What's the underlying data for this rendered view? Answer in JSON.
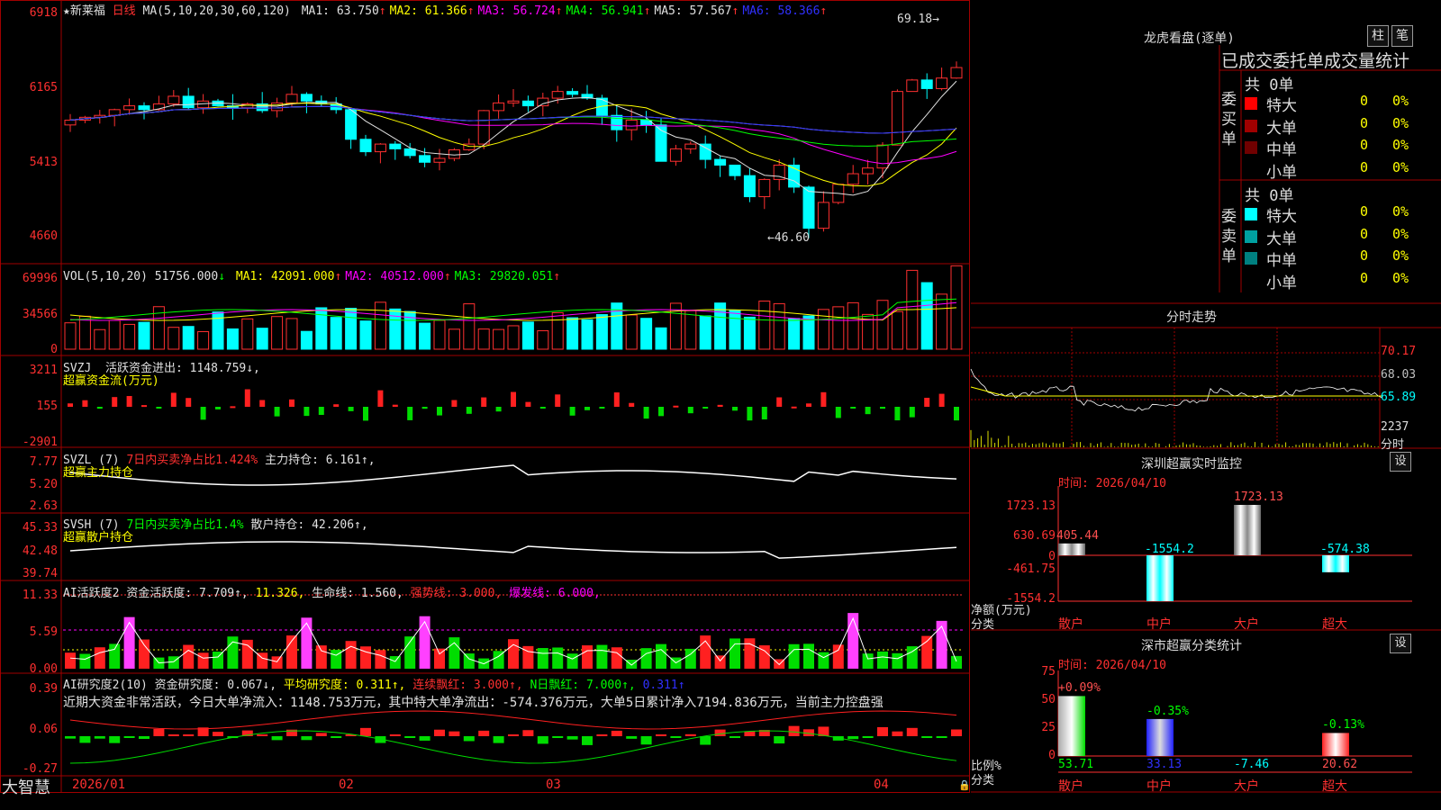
{
  "stock": {
    "name": "★新莱福",
    "period": "日线"
  },
  "main": {
    "ma_label": "MA(5,10,20,30,60,120)",
    "ma": [
      {
        "label": "MA1:",
        "value": "63.750",
        "arrow": "↑",
        "color": "#e0e0e0"
      },
      {
        "label": "MA2:",
        "value": "61.366",
        "arrow": "↑",
        "color": "#ffff00"
      },
      {
        "label": "MA3:",
        "value": "56.724",
        "arrow": "↑",
        "color": "#ff00ff"
      },
      {
        "label": "MA4:",
        "value": "56.941",
        "arrow": "↑",
        "color": "#00ff00"
      },
      {
        "label": "MA5:",
        "value": "57.567",
        "arrow": "↑",
        "color": "#e0e0e0"
      },
      {
        "label": "MA6:",
        "value": "58.366",
        "arrow": "↑",
        "color": "#3030ff"
      }
    ],
    "yticks": [
      "6918",
      "6165",
      "5413",
      "4660"
    ],
    "high_label": "69.18",
    "low_label": "46.60"
  },
  "vol": {
    "label": "VOL(5,10,20)",
    "value": "51756.000",
    "arrow": "↓",
    "ma": [
      {
        "label": "MA1:",
        "value": "42091.000",
        "arrow": "↑",
        "color": "#ffff00"
      },
      {
        "label": "MA2:",
        "value": "40512.000",
        "arrow": "↑",
        "color": "#ff00ff"
      },
      {
        "label": "MA3:",
        "value": "29820.051",
        "arrow": "↑",
        "color": "#00ff00"
      }
    ],
    "yticks": [
      "69996",
      "34566",
      "0"
    ]
  },
  "svzj": {
    "label": "SVZJ",
    "text1": "活跃资金进出: 1148.759↓,",
    "text2": "超赢资金流(万元)",
    "yticks": [
      "3211",
      "155",
      "-2901"
    ]
  },
  "svzl": {
    "label": "SVZL (7)",
    "text1": "7日内买卖净占比1.424%",
    "text2": "主力持仓: 6.161↑,",
    "text3": "超赢主力持仓",
    "yticks": [
      "7.77",
      "5.20",
      "2.63"
    ]
  },
  "svsh": {
    "label": "SVSH (7)",
    "text1": "7日内买卖净占比1.4%",
    "text2": "散户持仓: 42.206↑,",
    "text3": "超赢散户持仓",
    "yticks": [
      "45.33",
      "42.48",
      "39.74"
    ]
  },
  "ai1": {
    "label": "AI活跃度2",
    "text1": "资金活跃度: 7.709↑,",
    "text2": "11.326,",
    "text3": "生命线: 1.560,",
    "text4": "强势线: 3.000,",
    "text5": "爆发线: 6.000,",
    "yticks": [
      "11.33",
      "5.59",
      "0.00"
    ]
  },
  "ai2": {
    "label": "AI研究度2(10)",
    "text1": "资金研究度: 0.067↓,",
    "text2": "平均研究度: 0.311↑,",
    "text3": "连续飘红: 3.000↑,",
    "text4": "N日飘红: 7.000↑,",
    "text5": "0.311↑",
    "comment": "近期大资金非常活跃，今日大单净流入：1148.753万元，其中特大单净流出：-574.376万元，大单5日累计净入7194.836万元，当前主力控盘强",
    "yticks": [
      "0.39",
      "0.06",
      "-0.27"
    ]
  },
  "xaxis": {
    "brand": "大智慧",
    "labels": [
      "2026/01",
      "02",
      "03",
      "04"
    ]
  },
  "lhb": {
    "title": "龙虎看盘(逐单)",
    "btn1": "柱",
    "btn2": "笔",
    "subtitle": "已成交委托单成交量统计",
    "buy": {
      "side": "委买单",
      "total": "共 0单",
      "rows": [
        {
          "name": "特大",
          "v": "0",
          "p": "0%",
          "color": "#ff0000"
        },
        {
          "name": "大单",
          "v": "0",
          "p": "0%",
          "color": "#a00000"
        },
        {
          "name": "中单",
          "v": "0",
          "p": "0%",
          "color": "#700000"
        },
        {
          "name": "小单",
          "v": "0",
          "p": "0%",
          "color": ""
        }
      ]
    },
    "sell": {
      "side": "委卖单",
      "total": "共 0单",
      "rows": [
        {
          "name": "特大",
          "v": "0",
          "p": "0%",
          "color": "#00ffff"
        },
        {
          "name": "大单",
          "v": "0",
          "p": "0%",
          "color": "#00a0a0"
        },
        {
          "name": "中单",
          "v": "0",
          "p": "0%",
          "color": "#008080"
        },
        {
          "name": "小单",
          "v": "0",
          "p": "0%",
          "color": ""
        }
      ]
    }
  },
  "fs": {
    "title": "分时走势",
    "yticks": [
      "70.17",
      "68.03",
      "65.89",
      "2237",
      "分时"
    ]
  },
  "sz_monitor": {
    "title": "深圳超赢实时监控",
    "set": "设",
    "time": "时间: 2026/04/10",
    "yticks": [
      "1723.13",
      "630.69",
      "0",
      "-461.75",
      "-1554.2"
    ],
    "unit": "净额(万元)",
    "cat": "分类",
    "bars": [
      {
        "name": "散户",
        "value": 405.44,
        "label": "405.44"
      },
      {
        "name": "中户",
        "value": -1554.2,
        "label": "-1554.2"
      },
      {
        "name": "大户",
        "value": 1723.13,
        "label": "1723.13"
      },
      {
        "name": "超大",
        "value": -574.38,
        "label": "-574.38"
      }
    ]
  },
  "sz_class": {
    "title": "深市超赢分类统计",
    "set": "设",
    "time": "时间: 2026/04/10",
    "yticks": [
      "75",
      "50",
      "25",
      "0"
    ],
    "unit": "比例%",
    "cat": "分类",
    "bars": [
      {
        "name": "散户",
        "value": 53.71,
        "delta": "+0.09%",
        "label": "53.71"
      },
      {
        "name": "中户",
        "value": 33.13,
        "delta": "-0.35%",
        "label": "33.13"
      },
      {
        "name": "大户",
        "value": -7.46,
        "delta": "",
        "label": "-7.46"
      },
      {
        "name": "超大",
        "value": 20.62,
        "delta": "-0.13%",
        "label": "20.62"
      }
    ]
  }
}
